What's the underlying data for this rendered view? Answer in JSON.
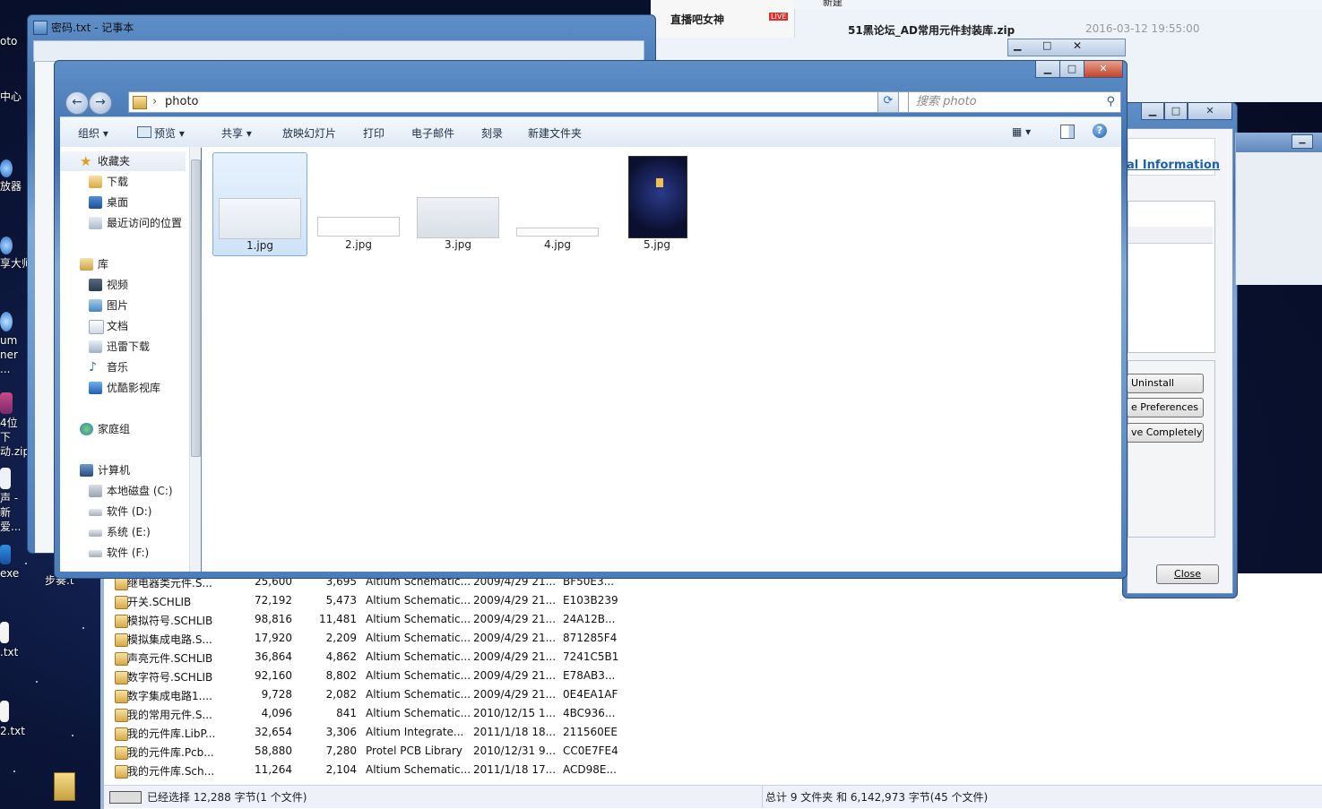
{
  "notepad": {
    "title": "密码.txt - 记事本"
  },
  "explorer": {
    "path": "photo",
    "search_placeholder": "搜索 photo",
    "toolbar": {
      "organize": "组织",
      "preview": "预览",
      "share": "共享",
      "slideshow": "放映幻灯片",
      "print": "打印",
      "email": "电子邮件",
      "burn": "刻录",
      "new_folder": "新建文件夹"
    },
    "nav": {
      "favorites": "收藏夹",
      "downloads": "下载",
      "desktop": "桌面",
      "recent": "最近访问的位置",
      "libraries": "库",
      "videos": "视频",
      "pictures": "图片",
      "documents": "文档",
      "xunlei": "迅雷下载",
      "music": "音乐",
      "youku": "优酷影视库",
      "homegroup": "家庭组",
      "computer": "计算机",
      "drive_c": "本地磁盘 (C:)",
      "drive_d": "软件 (D:)",
      "drive_e": "系统 (E:)",
      "drive_f": "软件 (F:)"
    },
    "files": [
      {
        "name": "1.jpg"
      },
      {
        "name": "2.jpg"
      },
      {
        "name": "3.jpg"
      },
      {
        "name": "4.jpg"
      },
      {
        "name": "5.jpg"
      }
    ]
  },
  "web": {
    "tab_title": "直播吧女神",
    "live_badge": "LIVE",
    "zip_name": "51黑论坛_AD常用元件封装库.zip",
    "zip_date": "2016-03-12 19:55:00",
    "new_label": "新建"
  },
  "app": {
    "link": "al Information",
    "uninstall": "Uninstall",
    "preferences": "e Preferences",
    "remove": "ve Completely",
    "close": "Close"
  },
  "desktop_icons": [
    {
      "label": "oto"
    },
    {
      "label": "中心"
    },
    {
      "label": "放器"
    },
    {
      "label": "享大师"
    },
    {
      "label": "um ner ..."
    },
    {
      "label": "4位下 动.zip"
    },
    {
      "label": "声 - 新爱..."
    },
    {
      "label": "exe"
    },
    {
      "label": "步奏.t"
    },
    {
      "label": ".txt"
    },
    {
      "label": "2.txt"
    }
  ],
  "archive_rows": [
    {
      "name": "继电器类元件.S...",
      "size": "25,600",
      "packed": "3,695",
      "type": "Altium Schematic...",
      "modified": "2009/4/29 21...",
      "crc": "BF50E3..."
    },
    {
      "name": "开关.SCHLIB",
      "size": "72,192",
      "packed": "5,473",
      "type": "Altium Schematic...",
      "modified": "2009/4/29 21...",
      "crc": "E103B239"
    },
    {
      "name": "模拟符号.SCHLIB",
      "size": "98,816",
      "packed": "11,481",
      "type": "Altium Schematic...",
      "modified": "2009/4/29 21...",
      "crc": "24A12B..."
    },
    {
      "name": "模拟集成电路.S...",
      "size": "17,920",
      "packed": "2,209",
      "type": "Altium Schematic...",
      "modified": "2009/4/29 21...",
      "crc": "871285F4"
    },
    {
      "name": "声亮元件.SCHLIB",
      "size": "36,864",
      "packed": "4,862",
      "type": "Altium Schematic...",
      "modified": "2009/4/29 21...",
      "crc": "7241C5B1"
    },
    {
      "name": "数字符号.SCHLIB",
      "size": "92,160",
      "packed": "8,802",
      "type": "Altium Schematic...",
      "modified": "2009/4/29 21...",
      "crc": "E78AB3..."
    },
    {
      "name": "数字集成电路1....",
      "size": "9,728",
      "packed": "2,082",
      "type": "Altium Schematic...",
      "modified": "2009/4/29 21...",
      "crc": "0E4EA1AF"
    },
    {
      "name": "我的常用元件.S...",
      "size": "4,096",
      "packed": "841",
      "type": "Altium Schematic...",
      "modified": "2010/12/15 1...",
      "crc": "4BC936..."
    },
    {
      "name": "我的元件库.LibP...",
      "size": "32,654",
      "packed": "3,306",
      "type": "Altium Integrate...",
      "modified": "2011/1/18 18...",
      "crc": "211560EE"
    },
    {
      "name": "我的元件库.Pcb...",
      "size": "58,880",
      "packed": "7,280",
      "type": "Protel PCB Library",
      "modified": "2010/12/31 9...",
      "crc": "CC0E7FE4"
    },
    {
      "name": "我的元件库.Sch...",
      "size": "11,264",
      "packed": "2,104",
      "type": "Altium Schematic...",
      "modified": "2011/1/18 17...",
      "crc": "ACD98E..."
    }
  ],
  "status": {
    "selected": "已经选择 12,288 字节(1 个文件)",
    "total": "总计 9 文件夹 和 6,142,973 字节(45 个文件)"
  }
}
